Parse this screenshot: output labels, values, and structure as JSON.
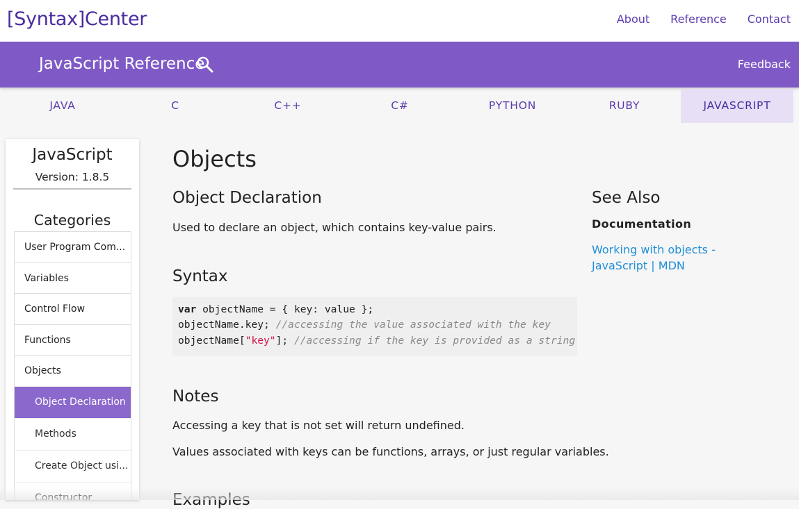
{
  "header": {
    "logo": "[Syntax]Center",
    "nav": [
      "About",
      "Reference",
      "Contact"
    ]
  },
  "subheader": {
    "title": "JavaScript Reference",
    "search_icon": "search-icon",
    "feedback": "Feedback",
    "bar_color": "#7f5ac6"
  },
  "languages": {
    "tabs": [
      "JAVA",
      "C",
      "C++",
      "C#",
      "PYTHON",
      "RUBY",
      "JAVASCRIPT"
    ],
    "active": "JAVASCRIPT"
  },
  "sidebar": {
    "title": "JavaScript",
    "version": "Version: 1.8.5",
    "categories_heading": "Categories",
    "categories": [
      "User Program Com...",
      "Variables",
      "Control Flow",
      "Functions",
      "Objects"
    ],
    "subitems": [
      "Object Declaration",
      "Methods",
      "Create Object usi...",
      "Constructor"
    ],
    "active_subitem": "Object Declaration",
    "active_color": "#8b68cc"
  },
  "main": {
    "title": "Objects",
    "declaration_heading": "Object Declaration",
    "declaration_text": "Used to declare an object, which contains key-value pairs.",
    "syntax_heading": "Syntax",
    "notes_heading": "Notes",
    "notes": [
      "Accessing a key that is not set will return undefined.",
      "Values associated with keys can be functions, arrays, or just regular variables."
    ],
    "next_heading": "Examples"
  },
  "code": {
    "line1_kw": "var",
    "line1_rest": " objectName = { key: value };",
    "line2_code": "objectName.key; ",
    "line2_comment": "//accessing the value associated with the key",
    "line3_code_a": "objectName[",
    "line3_string": "\"key\"",
    "line3_code_b": "]; ",
    "line3_comment": "//accessing if the key is provided as a string"
  },
  "see_also": {
    "heading": "See Also",
    "documentation_label": "Documentation",
    "link": "Working with objects - JavaScript | MDN",
    "link_color": "#1e8fd8"
  }
}
